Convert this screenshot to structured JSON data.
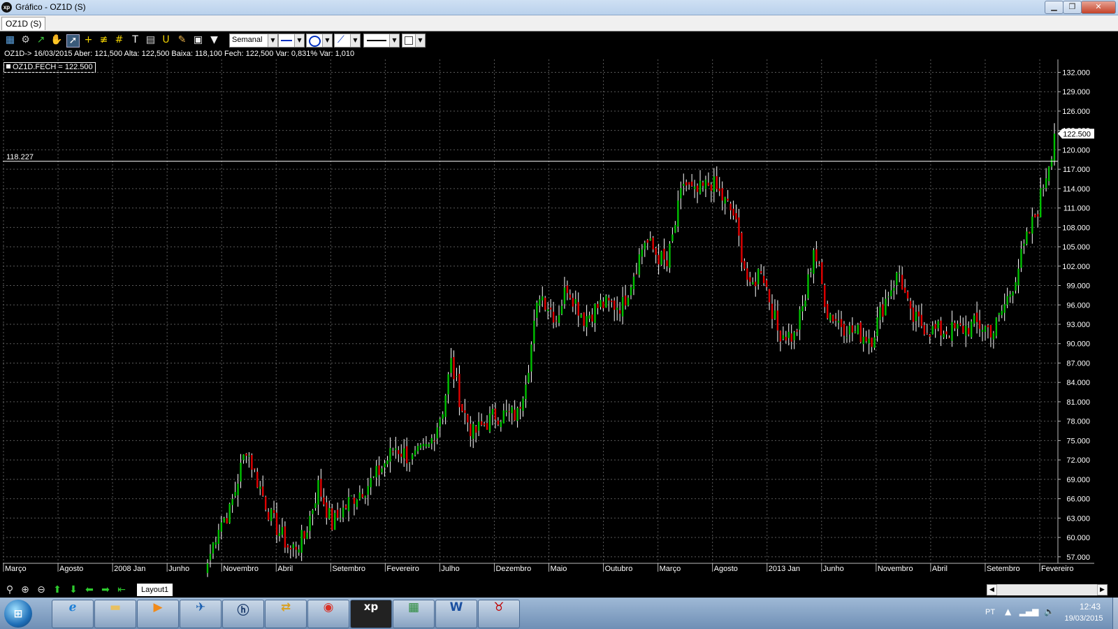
{
  "window": {
    "title": "Gráfico - OZ1D (S)",
    "app_icon_text": "xp",
    "min_icon": "minimize-icon",
    "max_icon": "restore-icon",
    "close_icon": "close-icon"
  },
  "tabs": [
    {
      "label": "OZ1D (S)"
    }
  ],
  "toolbar": {
    "period": "Semanal",
    "icons": [
      "chart-type-icon",
      "settings-gear-icon",
      "indicator-icon",
      "hand-pan-icon",
      "cursor-icon",
      "crosshair-icon",
      "parallel-lines-icon",
      "grid-icon",
      "text-icon",
      "calculator-icon",
      "magnet-icon",
      "eraser-icon",
      "bag-icon",
      "filter-icon"
    ],
    "line_style_icon": "line-style-icon",
    "ellipse_icon": "ellipse-tool-icon",
    "trendline_icon": "trendline-tool-icon",
    "line_width_icon": "line-width-icon",
    "color_icon": "color-box-icon"
  },
  "info_line": "OZ1D-> 16/03/2015 Aber: 121,500 Alta: 122,500 Baixa: 118,100 Fech: 122,500 Var: 0,831% Var: 1,010",
  "legend_label": "OZ1D.FECH = 122.500",
  "colors": {
    "up": "#00c000",
    "down": "#e00000",
    "wick": "#ffffff",
    "grid": "#5a5a5a",
    "text": "#ffffff"
  },
  "nav": {
    "layout_tab": "Layout1",
    "icons": [
      "search-icon",
      "zoom-in-icon",
      "zoom-out-icon",
      "arrow-up-icon",
      "arrow-down-icon",
      "arrow-left-icon",
      "arrow-right-icon",
      "go-end-icon"
    ]
  },
  "taskbar": {
    "apps": [
      "internet-explorer-icon",
      "file-explorer-icon",
      "media-player-icon",
      "outlook-icon",
      "hp-icon",
      "folder-sync-icon",
      "chrome-icon",
      "xp-investimentos-icon",
      "network-app-icon",
      "word-icon",
      "ms-bull-icon"
    ],
    "language": "PT",
    "time": "12:43",
    "date": "19/03/2015"
  },
  "chart_data": {
    "type": "candlestick",
    "title": "",
    "symbol": "OZ1D",
    "period": "Semanal",
    "x_tick_labels": [
      "Março",
      "Agosto",
      "2008 Jan",
      "Junho",
      "Novembro",
      "Abril",
      "Setembro",
      "Fevereiro",
      "Julho",
      "Dezembro",
      "Maio",
      "Outubro",
      "Março",
      "Agosto",
      "2013 Jan",
      "Junho",
      "Novembro",
      "Abril",
      "Setembro",
      "Fevereiro"
    ],
    "y_tick_labels": [
      "57.000",
      "60.000",
      "63.000",
      "66.000",
      "69.000",
      "72.000",
      "75.000",
      "78.000",
      "81.000",
      "84.000",
      "87.000",
      "90.000",
      "93.000",
      "96.000",
      "99.000",
      "102.000",
      "105.000",
      "108.000",
      "111.000",
      "114.000",
      "117.000",
      "120.000",
      "123.000",
      "126.000",
      "129.000",
      "132.000"
    ],
    "ylim": [
      56,
      134
    ],
    "last_price_label": "122.500",
    "horizontal_line": {
      "value": 118.227,
      "label": "118.227"
    },
    "grid": true,
    "keypoints": [
      {
        "i": 0,
        "p": 56
      },
      {
        "i": 4,
        "p": 62
      },
      {
        "i": 8,
        "p": 64
      },
      {
        "i": 14,
        "p": 74
      },
      {
        "i": 17,
        "p": 70
      },
      {
        "i": 23,
        "p": 63
      },
      {
        "i": 30,
        "p": 58
      },
      {
        "i": 35,
        "p": 60
      },
      {
        "i": 40,
        "p": 68
      },
      {
        "i": 45,
        "p": 62
      },
      {
        "i": 52,
        "p": 66
      },
      {
        "i": 60,
        "p": 69
      },
      {
        "i": 68,
        "p": 74
      },
      {
        "i": 74,
        "p": 72
      },
      {
        "i": 80,
        "p": 74
      },
      {
        "i": 85,
        "p": 80
      },
      {
        "i": 88,
        "p": 87
      },
      {
        "i": 92,
        "p": 80
      },
      {
        "i": 96,
        "p": 76
      },
      {
        "i": 104,
        "p": 79
      },
      {
        "i": 112,
        "p": 79
      },
      {
        "i": 116,
        "p": 87
      },
      {
        "i": 120,
        "p": 98
      },
      {
        "i": 126,
        "p": 94
      },
      {
        "i": 130,
        "p": 99
      },
      {
        "i": 136,
        "p": 94
      },
      {
        "i": 142,
        "p": 96
      },
      {
        "i": 150,
        "p": 96
      },
      {
        "i": 158,
        "p": 106
      },
      {
        "i": 166,
        "p": 102
      },
      {
        "i": 172,
        "p": 115
      },
      {
        "i": 176,
        "p": 113
      },
      {
        "i": 182,
        "p": 115
      },
      {
        "i": 190,
        "p": 110
      },
      {
        "i": 196,
        "p": 98
      },
      {
        "i": 200,
        "p": 102
      },
      {
        "i": 206,
        "p": 92
      },
      {
        "i": 212,
        "p": 91
      },
      {
        "i": 216,
        "p": 97
      },
      {
        "i": 219,
        "p": 105
      },
      {
        "i": 224,
        "p": 95
      },
      {
        "i": 232,
        "p": 92
      },
      {
        "i": 240,
        "p": 91
      },
      {
        "i": 246,
        "p": 98
      },
      {
        "i": 250,
        "p": 101
      },
      {
        "i": 254,
        "p": 94
      },
      {
        "i": 262,
        "p": 92
      },
      {
        "i": 270,
        "p": 92
      },
      {
        "i": 278,
        "p": 93
      },
      {
        "i": 284,
        "p": 92
      },
      {
        "i": 290,
        "p": 98
      },
      {
        "i": 296,
        "p": 106
      },
      {
        "i": 300,
        "p": 111
      },
      {
        "i": 305,
        "p": 120
      },
      {
        "i": 306,
        "p": 122.5
      }
    ]
  }
}
